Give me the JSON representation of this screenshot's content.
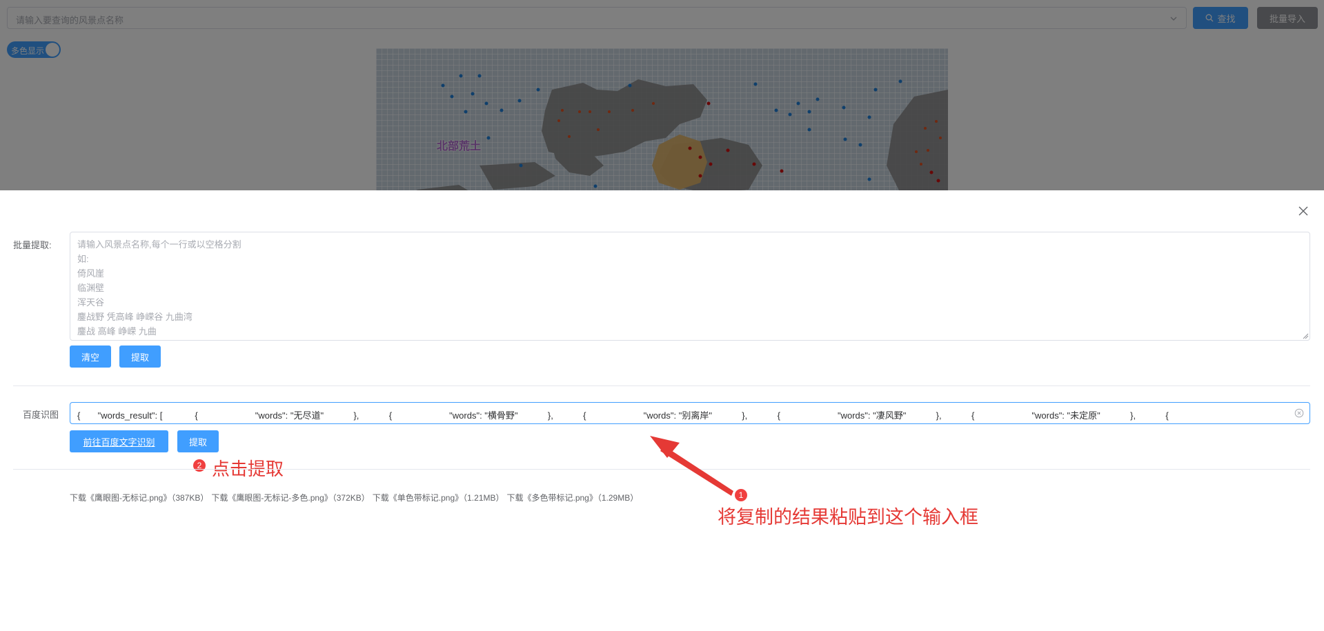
{
  "header": {
    "search_placeholder": "请输入要查询的风景点名称",
    "search_button_label": "查找",
    "import_button_label": "批量导入",
    "toggle_label": "多色显示"
  },
  "map": {
    "region_label": "北部荒土"
  },
  "dialog": {
    "batch_label": "批量提取:",
    "batch_placeholder": "请输入风景点名称,每个一行或以空格分割\n如:\n倚风崖\n临渊壁\n浑天谷\n鏖战野 凭高峰 峥嵘谷 九曲湾\n鏖战 高峰 峥嵘 九曲",
    "clear_button_label": "清空",
    "extract_button_label": "提取",
    "ocr_label": "百度识图",
    "ocr_value": "{       \"words_result\": [             {                       \"words\": \"无尽道\"            },            {                       \"words\": \"横骨野\"            },            {                       \"words\": \"别离岸\"            },            {                       \"words\": \"凄风野\"            },            {                       \"words\": \"未定原\"            },            {",
    "ocr_link_button_label": "前往百度文字识别",
    "ocr_extract_button_label": "提取",
    "downloads": [
      "下载《鹰眼图-无标记.png》（387KB）",
      "下载《鹰眼图-无标记-多色.png》（372KB）",
      "下载《单色带标记.png》（1.21MB）",
      "下载《多色带标记.png》（1.29MB）"
    ]
  },
  "annotations": {
    "step1_number": "1",
    "step1_text": "将复制的结果粘贴到这个输入框",
    "step2_number": "2",
    "step2_text": "点击提取"
  },
  "colors": {
    "primary": "#409eff",
    "annotation_red": "#e53935",
    "gray_button": "#909399"
  }
}
